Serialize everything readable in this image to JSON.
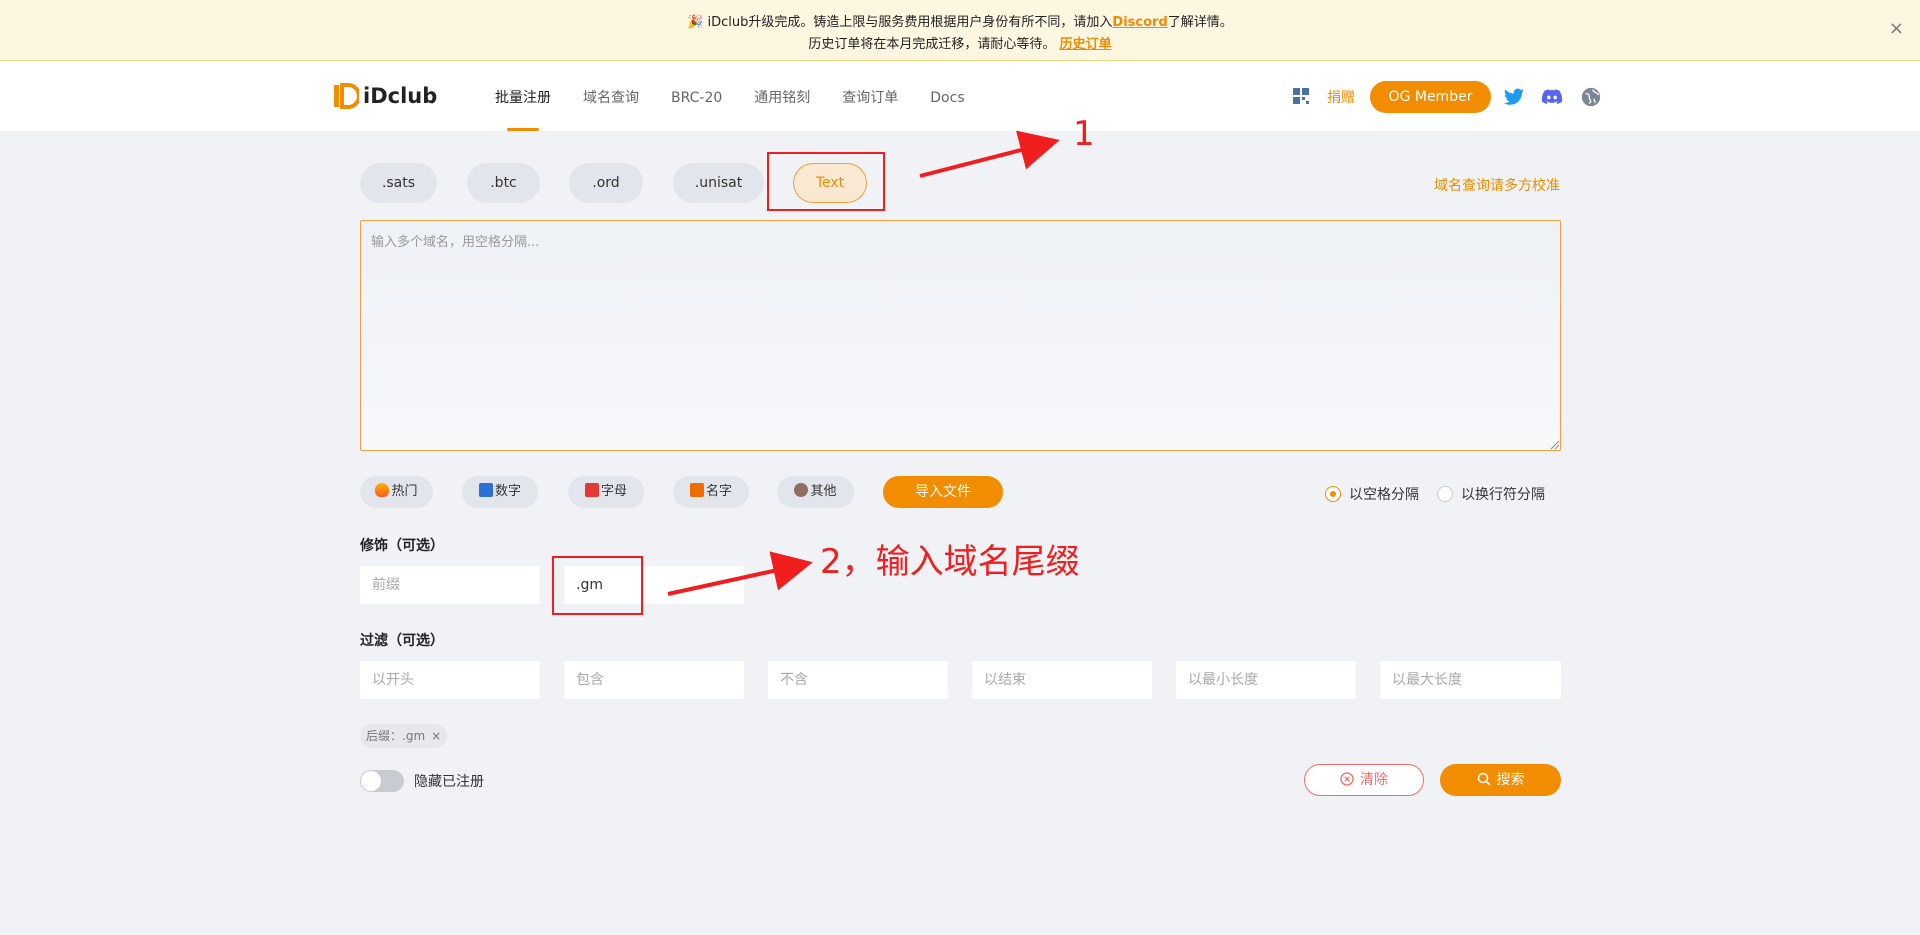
{
  "notice": {
    "line1_prefix": "🎉 iDclub升级完成。铸造上限与服务费用根据用户身份有所不同，请加入",
    "line1_link": "Discord",
    "line1_suffix": "了解详情。",
    "line2_prefix": "历史订单将在本月完成迁移，请耐心等待。",
    "line2_link": "历史订单",
    "close": "×"
  },
  "header": {
    "logo": "iDclub",
    "nav": [
      "批量注册",
      "域名查询",
      "BRC-20",
      "通用铭刻",
      "查询订单",
      "Docs"
    ],
    "donate": "捐赠",
    "member_button": "OG Member"
  },
  "tabs": [
    ".sats",
    ".btc",
    ".ord",
    ".unisat",
    "Text"
  ],
  "hint_link": "域名查询请多方校准",
  "textarea": {
    "placeholder": "输入多个域名，用空格分隔..."
  },
  "chips": [
    "热门",
    "数字",
    "字母",
    "名字",
    "其他"
  ],
  "import_button": "导入文件",
  "separators": [
    "以空格分隔",
    "以换行符分隔"
  ],
  "decoration": {
    "label": "修饰（可选）",
    "prefix_placeholder": "前缀",
    "suffix_value": ".gm"
  },
  "filter": {
    "label": "过滤（可选）",
    "placeholders": [
      "以开头",
      "包含",
      "不含",
      "以结束",
      "以最小长度",
      "以最大长度"
    ]
  },
  "tag": {
    "label": "后缀：",
    "value": ".gm",
    "remove": "×"
  },
  "toggle_label": "隐藏已注册",
  "clear_button": "清除",
  "search_button": "搜索",
  "annotations": {
    "one": "1",
    "two": "2，输入域名尾缀"
  },
  "colors": {
    "accent": "#f28c00",
    "danger": "#f56c6c",
    "annotation": "#f01e1e"
  }
}
